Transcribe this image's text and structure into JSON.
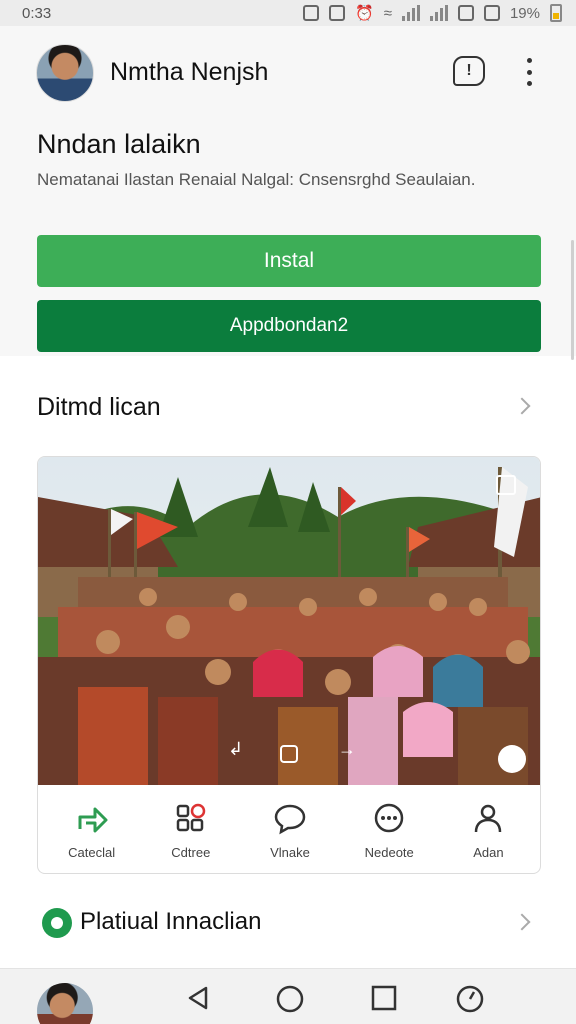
{
  "status_bar": {
    "time": "0:33",
    "battery": "19%"
  },
  "header": {
    "user_name": "Nmtha Nenjsh",
    "app_title": "Nndan lalaikn",
    "description": "Nematanai Ilastan Renaial Nalgal: Cnsensrghd Seaulaian.",
    "install_label": "Instal",
    "secondary_label": "Appdbondan2"
  },
  "section": {
    "title": "Ditmd lican"
  },
  "card": {
    "photo_icon": "photo-of-crowd-with-flags",
    "actions": [
      {
        "label": "Cateclal",
        "icon": "share-arrow-icon"
      },
      {
        "label": "Cdtree",
        "icon": "grid-icon"
      },
      {
        "label": "Vlnake",
        "icon": "chat-bubble-icon"
      },
      {
        "label": "Nedeote",
        "icon": "dots-circle-icon"
      },
      {
        "label": "Adan",
        "icon": "person-icon"
      }
    ]
  },
  "bottom": {
    "title": "Platiual Innaclian"
  },
  "colors": {
    "install": "#3dae57",
    "secondary": "#0b7d3d"
  }
}
